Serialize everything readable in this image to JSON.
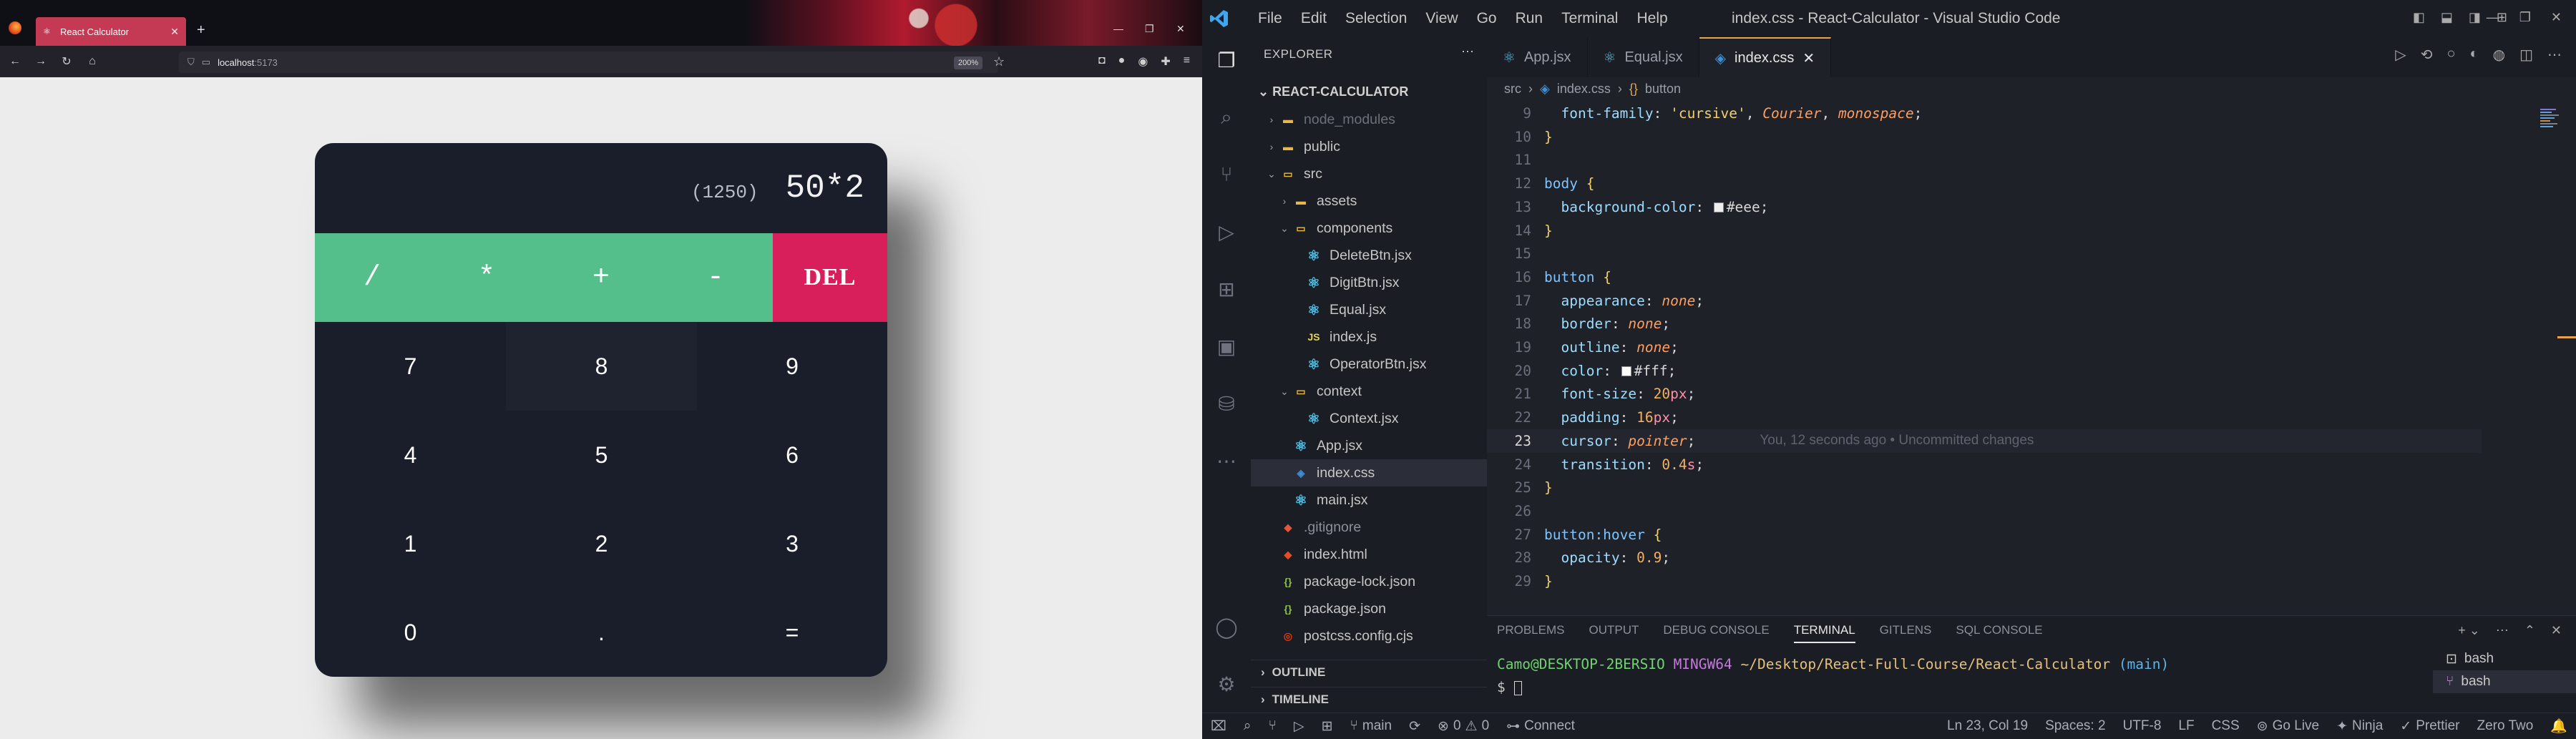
{
  "browser": {
    "tab_title": "React Calculator",
    "new_tab": "+",
    "url_host": "localhost",
    "url_port": ":5173",
    "zoom": "200%",
    "calculator": {
      "previous": "(1250)",
      "current": "50*2",
      "operators": [
        "/",
        "*",
        "+",
        "-"
      ],
      "delete_label": "DEL",
      "keys": [
        "7",
        "8",
        "9",
        "4",
        "5",
        "6",
        "1",
        "2",
        "3",
        "0",
        ".",
        "="
      ]
    }
  },
  "vscode": {
    "menu": [
      "File",
      "Edit",
      "Selection",
      "View",
      "Go",
      "Run",
      "Terminal",
      "Help"
    ],
    "window_title": "index.css - React-Calculator - Visual Studio Code",
    "explorer_title": "EXPLORER",
    "project": "REACT-CALCULATOR",
    "tree": [
      {
        "label": "node_modules",
        "kind": "folder-dim"
      },
      {
        "label": "public",
        "kind": "folder"
      },
      {
        "label": "src",
        "kind": "folder-open"
      },
      {
        "label": "assets",
        "kind": "folder"
      },
      {
        "label": "components",
        "kind": "folder-open"
      },
      {
        "label": "DeleteBtn.jsx",
        "kind": "react"
      },
      {
        "label": "DigitBtn.jsx",
        "kind": "react"
      },
      {
        "label": "Equal.jsx",
        "kind": "react"
      },
      {
        "label": "index.js",
        "kind": "js"
      },
      {
        "label": "OperatorBtn.jsx",
        "kind": "react"
      },
      {
        "label": "context",
        "kind": "folder-open"
      },
      {
        "label": "Context.jsx",
        "kind": "react"
      },
      {
        "label": "App.jsx",
        "kind": "react"
      },
      {
        "label": "index.css",
        "kind": "css"
      },
      {
        "label": "main.jsx",
        "kind": "react"
      },
      {
        "label": ".gitignore",
        "kind": "git"
      },
      {
        "label": "index.html",
        "kind": "html"
      },
      {
        "label": "package-lock.json",
        "kind": "json"
      },
      {
        "label": "package.json",
        "kind": "json"
      },
      {
        "label": "postcss.config.cjs",
        "kind": "postcss"
      }
    ],
    "outline": "OUTLINE",
    "timeline": "TIMELINE",
    "tabs": [
      "App.jsx",
      "Equal.jsx",
      "index.css"
    ],
    "breadcrumb": [
      "src",
      "index.css",
      "button"
    ],
    "code_lines": [
      {
        "n": "9",
        "text": "  font-family: 'cursive', Courier, monospace;"
      },
      {
        "n": "10",
        "text": "}"
      },
      {
        "n": "11",
        "text": ""
      },
      {
        "n": "12",
        "text": "body {"
      },
      {
        "n": "13",
        "text": "  background-color: #eee;"
      },
      {
        "n": "14",
        "text": "}"
      },
      {
        "n": "15",
        "text": ""
      },
      {
        "n": "16",
        "text": "button {"
      },
      {
        "n": "17",
        "text": "  appearance: none;"
      },
      {
        "n": "18",
        "text": "  border: none;"
      },
      {
        "n": "19",
        "text": "  outline: none;"
      },
      {
        "n": "20",
        "text": "  color: #fff;"
      },
      {
        "n": "21",
        "text": "  font-size: 20px;"
      },
      {
        "n": "22",
        "text": "  padding: 16px;"
      },
      {
        "n": "23",
        "text": "  cursor: pointer;"
      },
      {
        "n": "24",
        "text": "  transition: 0.4s;"
      },
      {
        "n": "25",
        "text": "}"
      },
      {
        "n": "26",
        "text": ""
      },
      {
        "n": "27",
        "text": "button:hover {"
      },
      {
        "n": "28",
        "text": "  opacity: 0.9;"
      },
      {
        "n": "29",
        "text": "}"
      }
    ],
    "blame": "You, 12 seconds ago • Uncommitted changes",
    "panel_tabs": [
      "PROBLEMS",
      "OUTPUT",
      "DEBUG CONSOLE",
      "TERMINAL",
      "GITLENS",
      "SQL CONSOLE"
    ],
    "terminal": {
      "user": "Camo@DESKTOP-2BERSIO",
      "system": "MINGW64",
      "path": "~/Desktop/React-Full-Course/React-Calculator",
      "branch": "(main)",
      "prompt": "$"
    },
    "terminal_list": [
      "bash",
      "bash"
    ],
    "status": {
      "branch": "main",
      "errors": "0",
      "warnings": "0",
      "connect": "Connect",
      "position": "Ln 23, Col 19",
      "spaces": "Spaces: 2",
      "encoding": "UTF-8",
      "eol": "LF",
      "language": "CSS",
      "golive": "Go Live",
      "ninja": "Ninja",
      "prettier": "Prettier",
      "zero": "Zero Two"
    }
  }
}
